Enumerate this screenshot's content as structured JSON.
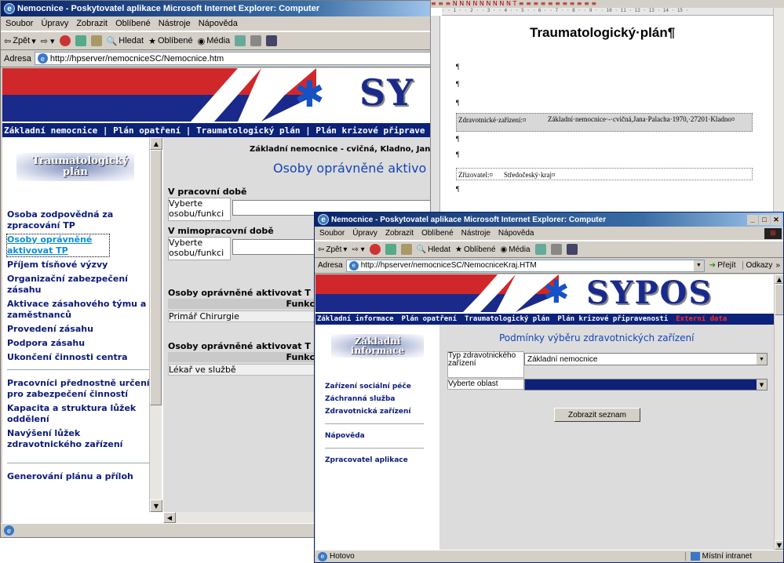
{
  "back_window": {
    "title": "Nemocnice - Poskytovatel aplikace Microsoft Internet Explorer: Computer",
    "menu": [
      "Soubor",
      "Úpravy",
      "Zobrazit",
      "Oblíbené",
      "Nástroje",
      "Nápověda"
    ],
    "toolbar": {
      "back": "Zpět",
      "search": "Hledat",
      "favorites": "Oblíbené",
      "media": "Média"
    },
    "address_label": "Adresa",
    "address": "http://hpserver/nemocniceSC/Nemocnice.htm",
    "logo_text": "SY",
    "nav": [
      "Základní nemocnice",
      "Plán opatření",
      "Traumatologický plán",
      "Plán krizové připrave"
    ],
    "sidebar_heading": "Traumatologický plán",
    "sidebar_links": [
      "Osoba zodpovědná za zpracování TP",
      "Osoby oprávněné aktivovat TP",
      "Příjem tísňové výzvy",
      "Organizační zabezpečení zásahu",
      "Aktivace zásahového týmu a zaměstnanců",
      "Provedení zásahu",
      "Podpora zásahu",
      "Ukončení činnosti centra",
      "Pracovníci přednostně určení pro zabezpečení činností",
      "Kapacita a struktura lůžek oddělení",
      "Navýšení lůžek zdravotnického zařízení",
      "Generování plánu a příloh"
    ],
    "content": {
      "hospital": "Základní nemocnice - cvičná, Kladno, Jan",
      "title": "Osoby oprávněné aktivo",
      "work_time": "V pracovní době",
      "off_time": "V mimopracovní době",
      "choose": "Vyberte osobu/funkci",
      "section1": "Osoby oprávněné aktivovat T",
      "col": "Funkce",
      "row1": "Primář Chirurgie",
      "section2": "Osoby oprávněné aktivovat T",
      "row2": "Lékař ve službě"
    }
  },
  "word_doc": {
    "heading": "Traumatologický·plán¶",
    "row1_label": "Zdravotnické·zařízení:¤",
    "row1_value": "Základní·nemocnice·-·cvičná,Jana·Palacha·1970,·27201·Kladno¤",
    "row2_label": "Zřizovatel:¤",
    "row2_value": "Středočeský·kraj¤",
    "pilcrow": "¶"
  },
  "front_window": {
    "title": "Nemocnice - Poskytovatel aplikace Microsoft Internet Explorer: Computer",
    "menu": [
      "Soubor",
      "Úpravy",
      "Zobrazit",
      "Oblíbené",
      "Nástroje",
      "Nápověda"
    ],
    "toolbar": {
      "back": "Zpět",
      "search": "Hledat",
      "favorites": "Oblíbené",
      "media": "Média"
    },
    "address_label": "Adresa",
    "address": "http://hpserver/nemocniceSC/NemocniceKraj.HTM",
    "go": "Přejít",
    "links": "Odkazy",
    "logo_text": "SYPOS",
    "nav": [
      "Základní informace",
      "Plán opatření",
      "Traumatologický plán",
      "Plán krizové připravenosti",
      "Externí data"
    ],
    "sidebar_heading": "Základní informace",
    "sidebar_links": [
      "Zařízení sociální péče",
      "Záchranná služba",
      "Zdravotnická zařízení",
      "Nápověda",
      "Zpracovatel aplikace"
    ],
    "form": {
      "title": "Podmínky výběru zdravotnických zařízení",
      "type_label": "Typ zdravotnického zařízení",
      "type_value": "Základní nemocnice",
      "area_label": "Vyberte oblast",
      "area_value": "",
      "button": "Zobrazit seznam"
    },
    "status": "Hotovo",
    "zone": "Místní intranet"
  },
  "colors": {
    "navy": "#0c2279",
    "titlebar": "#0a246a",
    "red": "#d0282a",
    "link": "#0b1a7a",
    "external": "#ff2a2a"
  }
}
